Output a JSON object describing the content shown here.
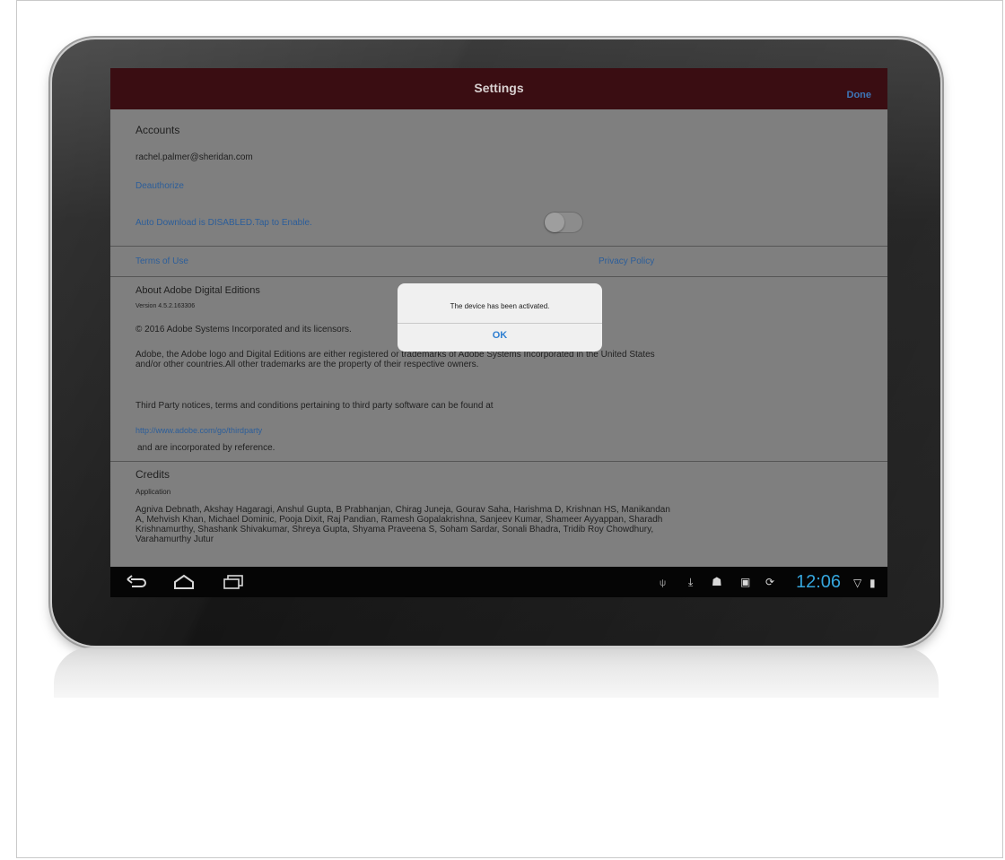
{
  "header": {
    "title": "Settings",
    "done_label": "Done"
  },
  "accounts": {
    "heading": "Accounts",
    "email": "rachel.palmer@sheridan.com",
    "deauthorize_label": "Deauthorize",
    "auto_download_label": "Auto Download is DISABLED.Tap to Enable."
  },
  "links": {
    "terms": "Terms of Use",
    "privacy": "Privacy Policy"
  },
  "about": {
    "heading": "About Adobe Digital Editions",
    "version": "Version 4.5.2.163306",
    "copyright": "© 2016 Adobe Systems Incorporated and its licensors.",
    "trademark": "Adobe, the Adobe logo and Digital Editions are either registered or trademarks of Adobe Systems Incorporated in the United States and/or other countries.All other trademarks are the property of their respective owners.",
    "third_party": "Third Party notices, terms and conditions pertaining to third party software can be found at",
    "third_party_url": "http://www.adobe.com/go/thirdparty",
    "incorporated": "and are incorporated by reference."
  },
  "credits": {
    "heading": "Credits",
    "subheading": "Application",
    "names": "Agniva Debnath, Akshay Hagaragi, Anshul Gupta, B Prabhanjan, Chirag Juneja, Gourav Saha, Harishma D, Krishnan HS, Manikandan A, Mehvish Khan, Michael Dominic, Pooja Dixit, Raj Pandian, Ramesh Gopalakrishna, Sanjeev Kumar, Shameer Ayyappan, Sharadh Krishnamurthy, Shashank Shivakumar, Shreya Gupta, Shyama Praveena S, Soham Sardar, Sonali Bhadra, Tridib Roy Chowdhury, Varahamurthy Jutur"
  },
  "dialog": {
    "message": "The device has been activated.",
    "ok_label": "OK"
  },
  "system_bar": {
    "clock": "12:06",
    "nav_icons": [
      "back-icon",
      "home-icon",
      "recent-apps-icon"
    ],
    "status_icons": [
      "usb-icon",
      "download-icon",
      "usb-debug-icon",
      "screenshot-icon",
      "sync-icon",
      "wifi-icon",
      "battery-icon"
    ]
  },
  "colors": {
    "navbar": "#3a0d12",
    "link": "#2c5e9a",
    "dialog_button": "#2f7fd1",
    "clock": "#35a5dc"
  }
}
